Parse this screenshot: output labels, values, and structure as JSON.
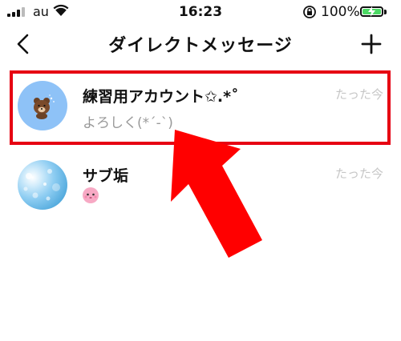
{
  "status_bar": {
    "carrier": "au",
    "time": "16:23",
    "battery_percent": "100%",
    "battery_level": 1.0,
    "icons": [
      "signal-icon",
      "wifi-icon",
      "orientation-lock-icon",
      "battery-charging-icon"
    ]
  },
  "nav": {
    "back_icon": "chevron-left-icon",
    "title": "ダイレクトメッセージ",
    "new_icon": "plus-icon"
  },
  "conversations": [
    {
      "name": "練習用アカウント✩.*˚",
      "preview": "よろしく(*´-`)",
      "time": "たった今",
      "avatar_icon": "bear-avatar-icon",
      "highlighted": true
    },
    {
      "name": "サブ垢",
      "preview": "",
      "preview_icon": "pink-face-sticker-icon",
      "time": "たった今",
      "avatar_icon": "blue-bokeh-avatar-icon",
      "highlighted": false
    }
  ],
  "annotation": {
    "highlight_color": "#e60012",
    "arrow_color": "#ff0000",
    "arrow_icon": "pointing-arrow-icon"
  }
}
